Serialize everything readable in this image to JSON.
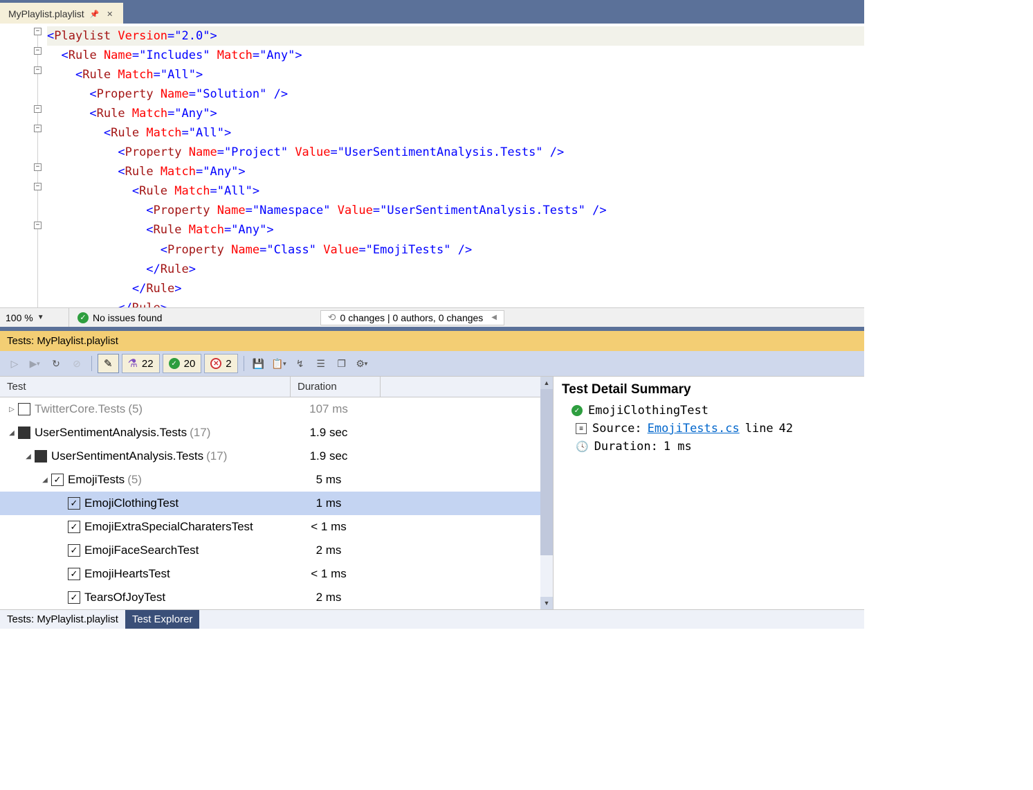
{
  "tab": {
    "title": "MyPlaylist.playlist"
  },
  "editor": {
    "lines": [
      {
        "indent": 0,
        "html": [
          {
            "c": "t-blue",
            "t": "<"
          },
          {
            "c": "t-brown",
            "t": "Playlist"
          },
          {
            "c": "",
            "t": " "
          },
          {
            "c": "t-red",
            "t": "Version"
          },
          {
            "c": "t-blue",
            "t": "=\"2.0\">"
          }
        ]
      },
      {
        "indent": 1,
        "html": [
          {
            "c": "t-blue",
            "t": "<"
          },
          {
            "c": "t-brown",
            "t": "Rule"
          },
          {
            "c": "",
            "t": " "
          },
          {
            "c": "t-red",
            "t": "Name"
          },
          {
            "c": "t-blue",
            "t": "=\"Includes\""
          },
          {
            "c": "",
            "t": " "
          },
          {
            "c": "t-red",
            "t": "Match"
          },
          {
            "c": "t-blue",
            "t": "=\"Any\">"
          }
        ]
      },
      {
        "indent": 2,
        "html": [
          {
            "c": "t-blue",
            "t": "<"
          },
          {
            "c": "t-brown",
            "t": "Rule"
          },
          {
            "c": "",
            "t": " "
          },
          {
            "c": "t-red",
            "t": "Match"
          },
          {
            "c": "t-blue",
            "t": "=\"All\">"
          }
        ]
      },
      {
        "indent": 3,
        "html": [
          {
            "c": "t-blue",
            "t": "<"
          },
          {
            "c": "t-brown",
            "t": "Property"
          },
          {
            "c": "",
            "t": " "
          },
          {
            "c": "t-red",
            "t": "Name"
          },
          {
            "c": "t-blue",
            "t": "=\"Solution\" />"
          }
        ]
      },
      {
        "indent": 3,
        "html": [
          {
            "c": "t-blue",
            "t": "<"
          },
          {
            "c": "t-brown",
            "t": "Rule"
          },
          {
            "c": "",
            "t": " "
          },
          {
            "c": "t-red",
            "t": "Match"
          },
          {
            "c": "t-blue",
            "t": "=\"Any\">"
          }
        ]
      },
      {
        "indent": 4,
        "html": [
          {
            "c": "t-blue",
            "t": "<"
          },
          {
            "c": "t-brown",
            "t": "Rule"
          },
          {
            "c": "",
            "t": " "
          },
          {
            "c": "t-red",
            "t": "Match"
          },
          {
            "c": "t-blue",
            "t": "=\"All\">"
          }
        ]
      },
      {
        "indent": 5,
        "html": [
          {
            "c": "t-blue",
            "t": "<"
          },
          {
            "c": "t-brown",
            "t": "Property"
          },
          {
            "c": "",
            "t": " "
          },
          {
            "c": "t-red",
            "t": "Name"
          },
          {
            "c": "t-blue",
            "t": "=\"Project\""
          },
          {
            "c": "",
            "t": " "
          },
          {
            "c": "t-red",
            "t": "Value"
          },
          {
            "c": "t-blue",
            "t": "=\"UserSentimentAnalysis.Tests\" />"
          }
        ]
      },
      {
        "indent": 5,
        "html": [
          {
            "c": "t-blue",
            "t": "<"
          },
          {
            "c": "t-brown",
            "t": "Rule"
          },
          {
            "c": "",
            "t": " "
          },
          {
            "c": "t-red",
            "t": "Match"
          },
          {
            "c": "t-blue",
            "t": "=\"Any\">"
          }
        ]
      },
      {
        "indent": 6,
        "html": [
          {
            "c": "t-blue",
            "t": "<"
          },
          {
            "c": "t-brown",
            "t": "Rule"
          },
          {
            "c": "",
            "t": " "
          },
          {
            "c": "t-red",
            "t": "Match"
          },
          {
            "c": "t-blue",
            "t": "=\"All\">"
          }
        ]
      },
      {
        "indent": 7,
        "html": [
          {
            "c": "t-blue",
            "t": "<"
          },
          {
            "c": "t-brown",
            "t": "Property"
          },
          {
            "c": "",
            "t": " "
          },
          {
            "c": "t-red",
            "t": "Name"
          },
          {
            "c": "t-blue",
            "t": "=\"Namespace\""
          },
          {
            "c": "",
            "t": " "
          },
          {
            "c": "t-red",
            "t": "Value"
          },
          {
            "c": "t-blue",
            "t": "=\"UserSentimentAnalysis.Tests\" />"
          }
        ]
      },
      {
        "indent": 7,
        "html": [
          {
            "c": "t-blue",
            "t": "<"
          },
          {
            "c": "t-brown",
            "t": "Rule"
          },
          {
            "c": "",
            "t": " "
          },
          {
            "c": "t-red",
            "t": "Match"
          },
          {
            "c": "t-blue",
            "t": "=\"Any\">"
          }
        ]
      },
      {
        "indent": 8,
        "html": [
          {
            "c": "t-blue",
            "t": "<"
          },
          {
            "c": "t-brown",
            "t": "Property"
          },
          {
            "c": "",
            "t": " "
          },
          {
            "c": "t-red",
            "t": "Name"
          },
          {
            "c": "t-blue",
            "t": "=\"Class\""
          },
          {
            "c": "",
            "t": " "
          },
          {
            "c": "t-red",
            "t": "Value"
          },
          {
            "c": "t-blue",
            "t": "=\"EmojiTests\" />"
          }
        ]
      },
      {
        "indent": 7,
        "html": [
          {
            "c": "t-blue",
            "t": "</"
          },
          {
            "c": "t-brown",
            "t": "Rule"
          },
          {
            "c": "t-blue",
            "t": ">"
          }
        ]
      },
      {
        "indent": 6,
        "html": [
          {
            "c": "t-blue",
            "t": "</"
          },
          {
            "c": "t-brown",
            "t": "Rule"
          },
          {
            "c": "t-blue",
            "t": ">"
          }
        ]
      },
      {
        "indent": 5,
        "html": [
          {
            "c": "t-blue",
            "t": "</"
          },
          {
            "c": "t-brown",
            "t": "Rule"
          },
          {
            "c": "t-blue",
            "t": ">"
          }
        ]
      }
    ]
  },
  "status": {
    "zoom": "100 %",
    "issues": "No issues found",
    "changes": "0 changes | 0 authors, 0 changes"
  },
  "tests_header": "Tests: MyPlaylist.playlist",
  "toolbar": {
    "total_count": "22",
    "pass_count": "20",
    "fail_count": "2"
  },
  "grid": {
    "col_test": "Test",
    "col_duration": "Duration",
    "rows": [
      {
        "depth": 0,
        "exp": "▷",
        "chk": "empty",
        "name": "TwitterCore.Tests",
        "count": "(5)",
        "dim": true,
        "dur": "107 ms",
        "sel": false
      },
      {
        "depth": 0,
        "exp": "◢",
        "chk": "filled",
        "name": "UserSentimentAnalysis.Tests",
        "count": "(17)",
        "dim": false,
        "dur": "1.9 sec",
        "sel": false
      },
      {
        "depth": 1,
        "exp": "◢",
        "chk": "filled",
        "name": "UserSentimentAnalysis.Tests",
        "count": "(17)",
        "dim": false,
        "dur": "1.9 sec",
        "sel": false
      },
      {
        "depth": 2,
        "exp": "◢",
        "chk": "checked",
        "name": "EmojiTests",
        "count": "(5)",
        "dim": false,
        "dur": "5 ms",
        "sel": false
      },
      {
        "depth": 3,
        "exp": "",
        "chk": "checked",
        "name": "EmojiClothingTest",
        "count": "",
        "dim": false,
        "dur": "1 ms",
        "sel": true
      },
      {
        "depth": 3,
        "exp": "",
        "chk": "checked",
        "name": "EmojiExtraSpecialCharatersTest",
        "count": "",
        "dim": false,
        "dur": "< 1 ms",
        "sel": false
      },
      {
        "depth": 3,
        "exp": "",
        "chk": "checked",
        "name": "EmojiFaceSearchTest",
        "count": "",
        "dim": false,
        "dur": "2 ms",
        "sel": false
      },
      {
        "depth": 3,
        "exp": "",
        "chk": "checked",
        "name": "EmojiHeartsTest",
        "count": "",
        "dim": false,
        "dur": "< 1 ms",
        "sel": false
      },
      {
        "depth": 3,
        "exp": "",
        "chk": "checked",
        "name": "TearsOfJoyTest",
        "count": "",
        "dim": false,
        "dur": "2 ms",
        "sel": false
      }
    ]
  },
  "detail": {
    "title": "Test Detail Summary",
    "name": "EmojiClothingTest",
    "source_label": "Source:",
    "source_file": "EmojiTests.cs",
    "source_line_label": "line",
    "source_line": "42",
    "duration_label": "Duration:",
    "duration_value": "1 ms"
  },
  "bottom_tabs": {
    "tab1": "Tests: MyPlaylist.playlist",
    "tab2": "Test Explorer"
  }
}
